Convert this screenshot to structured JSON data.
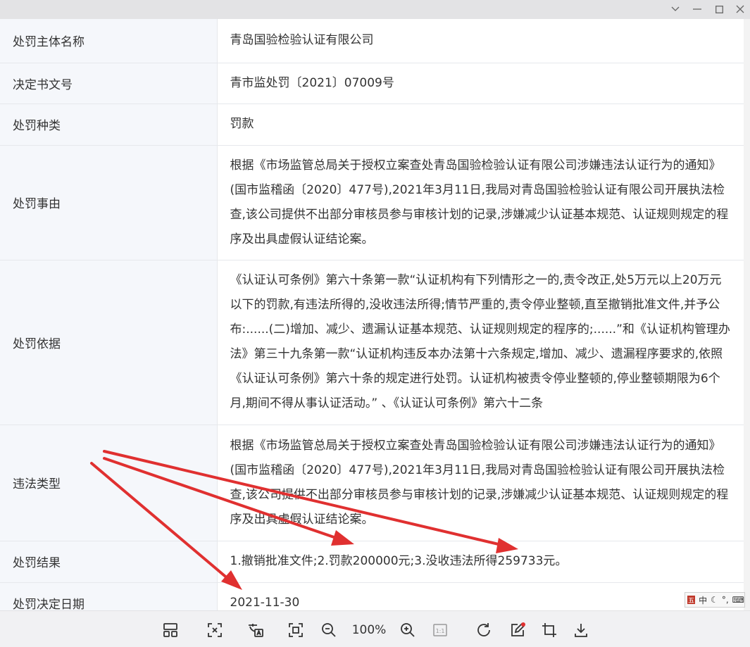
{
  "table": {
    "rows": [
      {
        "label": "处罚主体名称",
        "value": "青岛国验检验认证有限公司"
      },
      {
        "label": "决定书文号",
        "value": "青市监处罚〔2021〕07009号"
      },
      {
        "label": "处罚种类",
        "value": "罚款"
      },
      {
        "label": "处罚事由",
        "value": "根据《市场监管总局关于授权立案查处青岛国验检验认证有限公司涉嫌违法认证行为的通知》(国市监稽函〔2020〕477号),2021年3月11日,我局对青岛国验检验认证有限公司开展执法检查,该公司提供不出部分审核员参与审核计划的记录,涉嫌减少认证基本规范、认证规则规定的程序及出具虚假认证结论案。"
      },
      {
        "label": "处罚依据",
        "value": "《认证认可条例》第六十条第一款“认证机构有下列情形之一的,责令改正,处5万元以上20万元以下的罚款,有违法所得的,没收违法所得;情节严重的,责令停业整顿,直至撤销批准文件,并予公布:......(二)增加、减少、遗漏认证基本规范、认证规则规定的程序的;......”和《认证机构管理办法》第三十九条第一款“认证机构违反本办法第十六条规定,增加、减少、遗漏程序要求的,依照《认证认可条例》第六十条的规定进行处罚。认证机构被责令停业整顿的,停业整顿期限为6个月,期间不得从事认证活动。” 、《认证认可条例》第六十二条"
      },
      {
        "label": "违法类型",
        "value": "根据《市场监管总局关于授权立案查处青岛国验检验认证有限公司涉嫌违法认证行为的通知》(国市监稽函〔2020〕477号),2021年3月11日,我局对青岛国验检验认证有限公司开展执法检查,该公司提供不出部分审核员参与审核计划的记录,涉嫌减少认证基本规范、认证规则规定的程序及出具虚假认证结论案。"
      },
      {
        "label": "处罚结果",
        "value": "1.撤销批准文件;2.罚款200000元;3.没收违法所得259733元。"
      },
      {
        "label": "处罚决定日期",
        "value": "2021-11-30"
      }
    ]
  },
  "toolbar": {
    "zoom": "100%",
    "icons": [
      "layout-icon",
      "fit-icon",
      "ocr-icon",
      "fullscreen-icon",
      "zoom-out-icon",
      "zoom-in-icon",
      "actual-size-icon",
      "rotate-icon",
      "edit-icon",
      "crop-icon",
      "download-icon"
    ],
    "actual_size_text": "1:1"
  },
  "ime": {
    "mode": "中"
  },
  "colors": {
    "label_bg": "#f5f7fb",
    "border": "#e6e8ec",
    "arrow": "#e03030",
    "toolbar_bg": "#f1f1f3"
  }
}
